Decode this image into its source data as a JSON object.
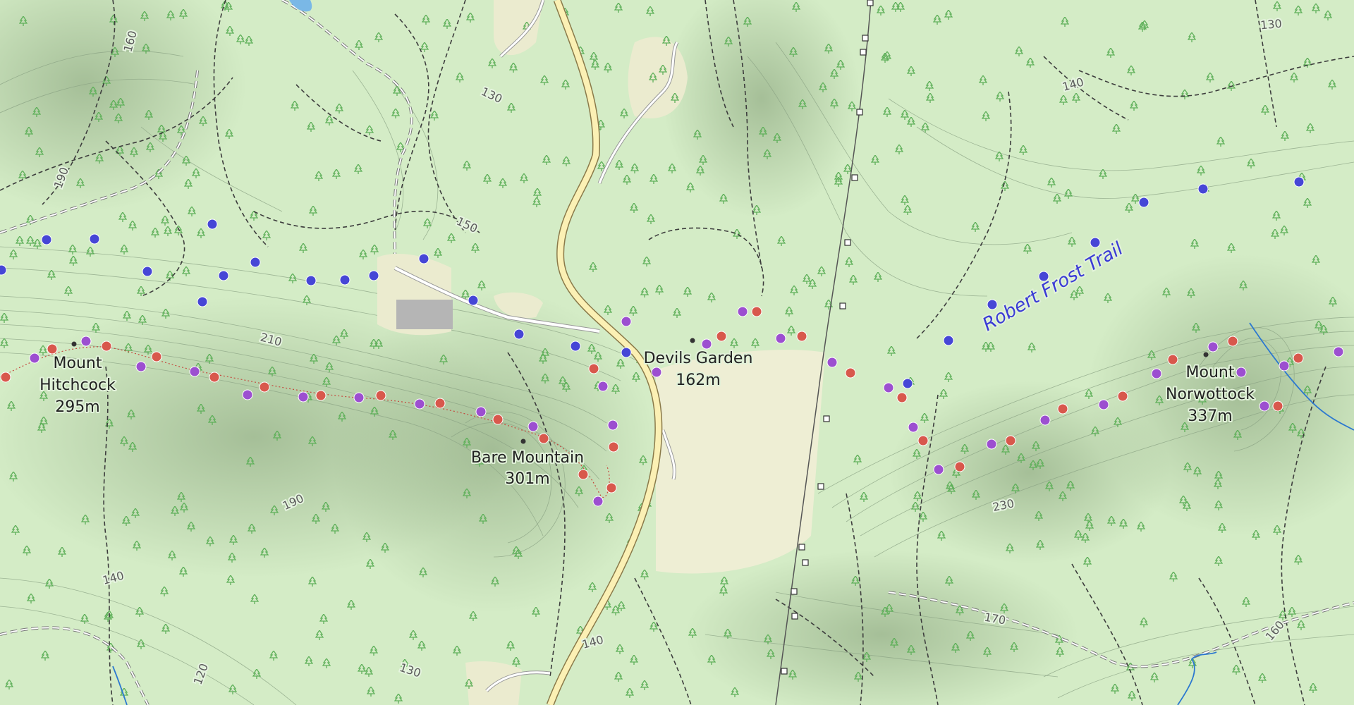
{
  "map": {
    "peaks": [
      {
        "name": "Mount",
        "name2": "Hitchcock",
        "elev": "295m"
      },
      {
        "name": "Bare Mountain",
        "elev": "301m"
      },
      {
        "name": "Devils Garden",
        "elev": "162m"
      },
      {
        "name": "Mount",
        "name2": "Norwottock",
        "elev": "337m"
      }
    ],
    "trail_label": "Robert Frost Trail",
    "contour_labels": [
      "160",
      "190",
      "130",
      "150",
      "210",
      "190",
      "140",
      "120",
      "130",
      "140",
      "170",
      "230",
      "140",
      "130",
      "160"
    ],
    "colors": {
      "forest": "#d4ecc6",
      "clearing": "#f2f2d8",
      "road": "#fbf0b4",
      "trail_blue": "#4646d6",
      "trail_purple": "#9c4fd0",
      "trail_red": "#d8584c",
      "stream": "#2b78d0"
    }
  }
}
